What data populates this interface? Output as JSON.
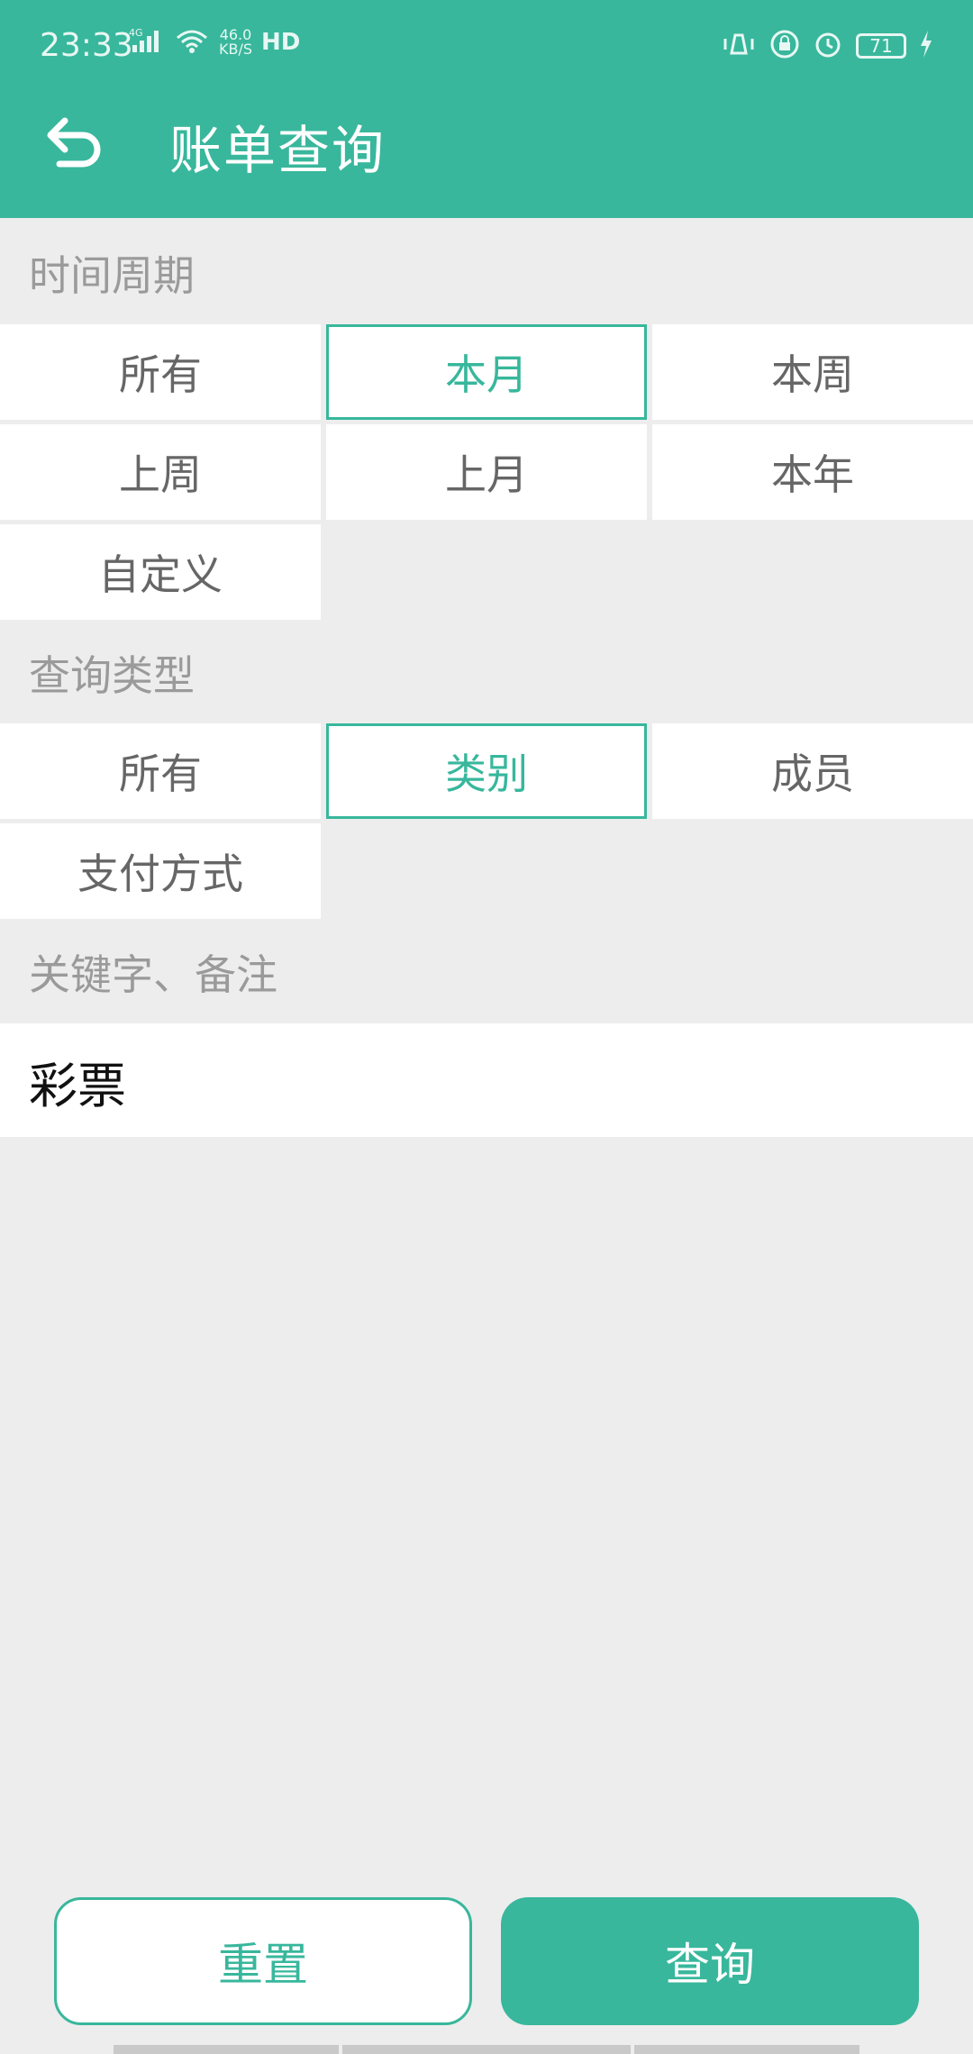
{
  "status_bar": {
    "time": "23:33",
    "network": "4G",
    "speed_value": "46.0",
    "speed_unit": "KB/S",
    "hd": "HD",
    "battery": "71"
  },
  "header": {
    "title": "账单查询"
  },
  "sections": {
    "time_period": {
      "label": "时间周期",
      "options": [
        "所有",
        "本月",
        "本周",
        "上周",
        "上月",
        "本年",
        "自定义"
      ],
      "selected": "本月"
    },
    "query_type": {
      "label": "查询类型",
      "options": [
        "所有",
        "类别",
        "成员",
        "支付方式"
      ],
      "selected": "类别"
    },
    "keyword": {
      "label": "关键字、备注",
      "value": "彩票"
    }
  },
  "buttons": {
    "reset": "重置",
    "query": "查询"
  },
  "colors": {
    "accent": "#38b79c",
    "background": "#ededed",
    "label": "#9a9a9a"
  }
}
